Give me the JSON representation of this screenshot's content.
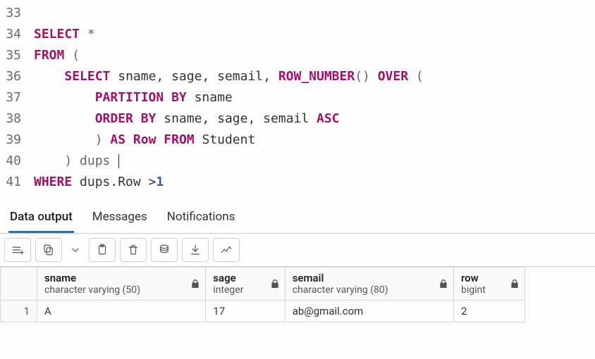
{
  "editor": {
    "lines": [
      {
        "n": 33,
        "tokens": []
      },
      {
        "n": 34,
        "tokens": [
          {
            "t": "SELECT",
            "c": "kw"
          },
          {
            "t": " *",
            "c": "punc"
          }
        ]
      },
      {
        "n": 35,
        "tokens": [
          {
            "t": "FROM",
            "c": "kw"
          },
          {
            "t": " (",
            "c": "punc"
          }
        ]
      },
      {
        "n": 36,
        "tokens": [
          {
            "t": "    ",
            "c": "id"
          },
          {
            "t": "SELECT",
            "c": "kw"
          },
          {
            "t": " sname, sage, semail, ",
            "c": "id"
          },
          {
            "t": "ROW_NUMBER",
            "c": "fn"
          },
          {
            "t": "() ",
            "c": "punc"
          },
          {
            "t": "OVER",
            "c": "kw"
          },
          {
            "t": " (",
            "c": "punc"
          }
        ]
      },
      {
        "n": 37,
        "tokens": [
          {
            "t": "        ",
            "c": "id"
          },
          {
            "t": "PARTITION BY",
            "c": "kw"
          },
          {
            "t": " sname",
            "c": "id"
          }
        ]
      },
      {
        "n": 38,
        "tokens": [
          {
            "t": "        ",
            "c": "id"
          },
          {
            "t": "ORDER BY",
            "c": "kw"
          },
          {
            "t": " sname, sage, semail ",
            "c": "id"
          },
          {
            "t": "ASC",
            "c": "kw"
          }
        ]
      },
      {
        "n": 39,
        "tokens": [
          {
            "t": "        ) ",
            "c": "punc"
          },
          {
            "t": "AS",
            "c": "kw"
          },
          {
            "t": " ",
            "c": "id"
          },
          {
            "t": "Row",
            "c": "kw"
          },
          {
            "t": " ",
            "c": "id"
          },
          {
            "t": "FROM",
            "c": "kw"
          },
          {
            "t": " Student",
            "c": "id"
          }
        ]
      },
      {
        "n": 40,
        "tokens": [
          {
            "t": "    ) dups ",
            "c": "punc"
          }
        ],
        "cursor": true
      },
      {
        "n": 41,
        "tokens": [
          {
            "t": "WHERE",
            "c": "kw"
          },
          {
            "t": " dups.Row >",
            "c": "id"
          },
          {
            "t": "1",
            "c": "num"
          }
        ]
      }
    ]
  },
  "tabs": {
    "items": [
      {
        "label": "Data output",
        "active": true
      },
      {
        "label": "Messages",
        "active": false
      },
      {
        "label": "Notifications",
        "active": false
      }
    ]
  },
  "toolbar": {
    "buttons": [
      {
        "name": "add-row-icon"
      },
      {
        "name": "copy-icon"
      },
      {
        "name": "dropdown-caret-icon"
      },
      {
        "name": "paste-icon"
      },
      {
        "name": "delete-icon"
      },
      {
        "name": "save-data-icon"
      },
      {
        "name": "download-icon"
      },
      {
        "name": "chart-icon"
      }
    ]
  },
  "results": {
    "columns": [
      {
        "name": "sname",
        "type": "character varying (50)",
        "align": "left"
      },
      {
        "name": "sage",
        "type": "integer",
        "align": "right"
      },
      {
        "name": "semail",
        "type": "character varying (80)",
        "align": "left"
      },
      {
        "name": "row",
        "type": "bigint",
        "align": "right"
      }
    ],
    "rows": [
      {
        "n": 1,
        "cells": [
          "A",
          "17",
          "ab@gmail.com",
          "2"
        ]
      }
    ]
  }
}
